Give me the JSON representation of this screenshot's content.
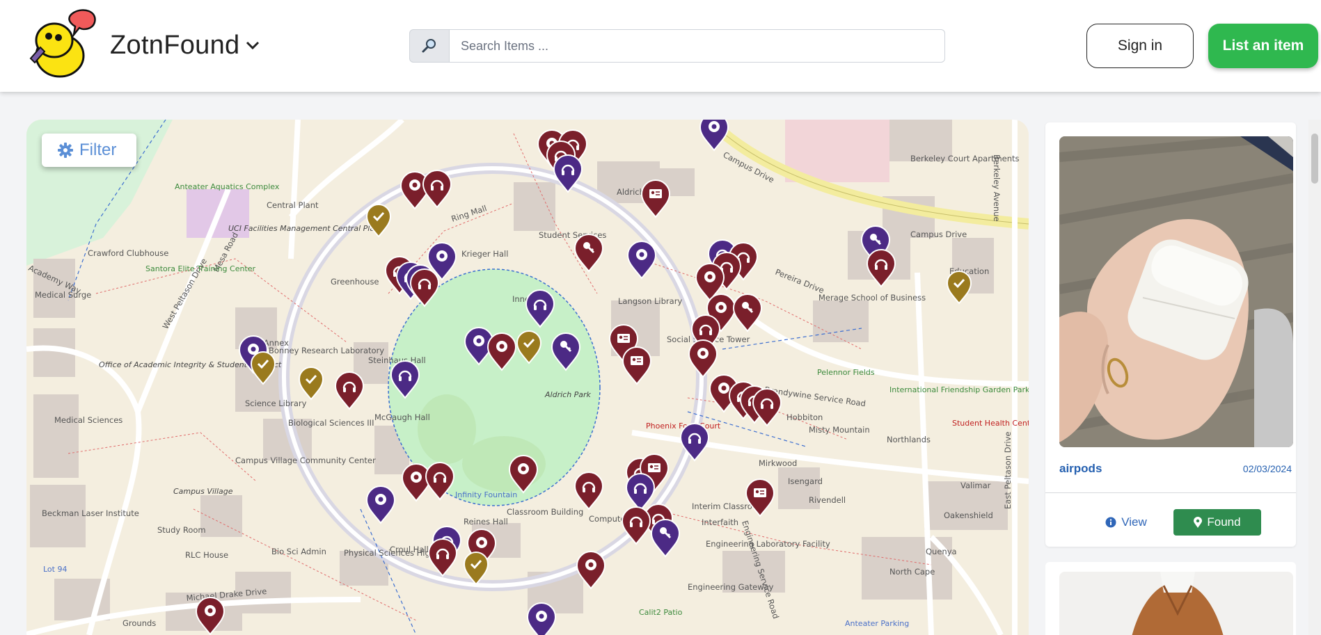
{
  "header": {
    "brand": "ZotnFound",
    "search_placeholder": "Search Items ...",
    "sign_in_label": "Sign in",
    "list_item_label": "List an item"
  },
  "icons": [
    "logo-anteater-icon",
    "chevron-down-icon",
    "search-icon",
    "gear-icon",
    "info-icon",
    "map-marker-icon",
    "headphones-icon",
    "key-icon",
    "id-card-icon",
    "check-icon"
  ],
  "colors": {
    "brand_green": "#2fb84f",
    "marker_maroon": "#7a1f2b",
    "marker_purple": "#4c2a85",
    "marker_gold": "#9a7a1e",
    "link_blue": "#2560b0",
    "found_green": "#2f8c4f"
  },
  "map": {
    "filter_label": "Filter",
    "labels": {
      "aldrich_park": "Aldrich Park",
      "inner_ring": "Inner Ring",
      "ring_mall": "Ring Mall",
      "campus_drive": "Campus Drive",
      "pereira_drive": "Pereira Drive",
      "west_peltason": "West Peltason Drive",
      "east_peltason": "East Peltason Drive",
      "michael_drake": "Michael Drake Drive",
      "brandywine": "Brandywine Service Road",
      "academy_way": "Academy Way",
      "mesa_road": "Mesa Road",
      "langson": "Langson Library",
      "student_services": "Student Services",
      "krieger": "Krieger Hall",
      "aldrich_hall": "Aldrich Hall",
      "steinhaus": "Steinhaus Hall",
      "bonney": "Bonney Research Laboratory",
      "arts_annex": "Arts Annex",
      "bio_sci": "Biological Sciences III",
      "mcgaugh": "McGaugh Hall",
      "reines": "Reines Hall",
      "croul": "Croul Hall",
      "phys_sci": "Physical Sciences High Bay",
      "bio_admin": "Bio Sci Admin",
      "rlc_house": "RLC House",
      "campus_village": "Campus Village",
      "campus_village_cc": "Campus Village Community Center",
      "beckman": "Beckman Laser Institute",
      "medical_surge": "Medical Surge",
      "medical_sciences": "Medical Sciences",
      "crawford": "Crawford Clubhouse",
      "greenhouse": "Greenhouse",
      "central_plant": "Central Plant",
      "uci_facilities": "UCI Facilities Management Central Plant",
      "anteater_aquatics": "Anteater Aquatics Complex",
      "santora": "Santora Elite Training Center",
      "social_science_tower": "Social Science Tower",
      "merage": "Merage School of Business",
      "pelennor": "Pelennor Fields",
      "intl_park": "International Friendship Garden Park",
      "student_health": "Student Health Center",
      "education": "Education",
      "berkeley_court": "Berkeley Court Apartments",
      "hobbiton": "Hobbiton",
      "misty_mountain": "Misty Mountain",
      "mirkwood": "Mirkwood",
      "isengard": "Isengard",
      "rivendell": "Rivendell",
      "northlands": "Northlands",
      "valimar": "Valimar",
      "oakenshield": "Oakenshield",
      "quenya": "Quenya",
      "north_cape": "North Cape",
      "interim_classroom": "Interim Classroom",
      "interfaith": "Interfaith",
      "eng_lab": "Engineering Laboratory Facility",
      "eng_gateway": "Engineering Gateway",
      "calit2": "Calit2 Patio",
      "phoenix": "Phoenix Food Court",
      "infinity": "Infinity Fountain",
      "classroom_building": "Classroom Building",
      "computer_science": "Computer Science",
      "engineering_service_road": "Engineering Service Road",
      "science_library": "Science Library",
      "academic_integrity": "Office of Academic Integrity & Student Conduct",
      "campus_drive_2": "Campus Drive",
      "grounds": "Grounds",
      "berkeley_avenue": "Berkeley Avenue",
      "anteater_parking": "Anteater Parking",
      "study_room": "Study Room",
      "lot_94": "Lot 94"
    }
  },
  "listing": {
    "item_name": "airpods",
    "item_date": "02/03/2024",
    "view_label": "View",
    "found_label": "Found"
  }
}
